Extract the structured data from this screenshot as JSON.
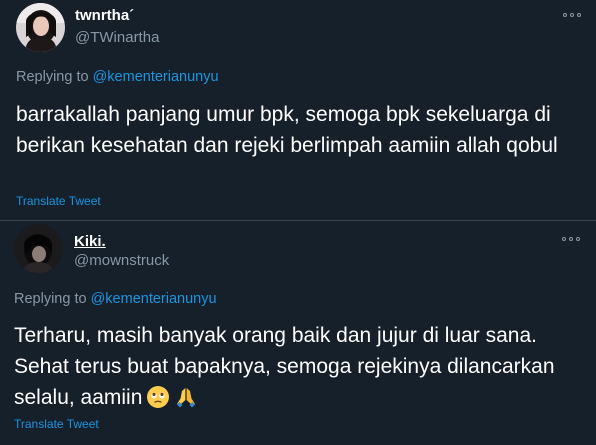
{
  "tweets": [
    {
      "display_name": "twnrtha´",
      "handle": "@TWinartha",
      "replying_prefix": "Replying to",
      "replying_to": "@kementerianunyu",
      "text": "barrakallah panjang umur bpk, semoga bpk sekeluarga di berikan kesehatan dan rejeki berlimpah aamiin allah qobul",
      "translate_label": "Translate Tweet",
      "avatar_icon": "profile-photo-woman"
    },
    {
      "display_name": "Kiki.",
      "handle": "@mownstruck",
      "replying_prefix": "Replying to",
      "replying_to": "@kementerianunyu",
      "text": "Terharu, masih banyak orang baik dan jujur di luar sana. Sehat terus buat bapaknya, semoga rejekinya dilancarkan selalu, aamiin",
      "emojis": [
        "face-holding-back-tears-icon",
        "folded-hands-icon"
      ],
      "translate_label": "Translate Tweet",
      "avatar_icon": "profile-photo-person"
    }
  ],
  "colors": {
    "background": "#15202b",
    "secondary_text": "#8899a6",
    "link": "#1b95e0",
    "divider": "#38444d"
  }
}
